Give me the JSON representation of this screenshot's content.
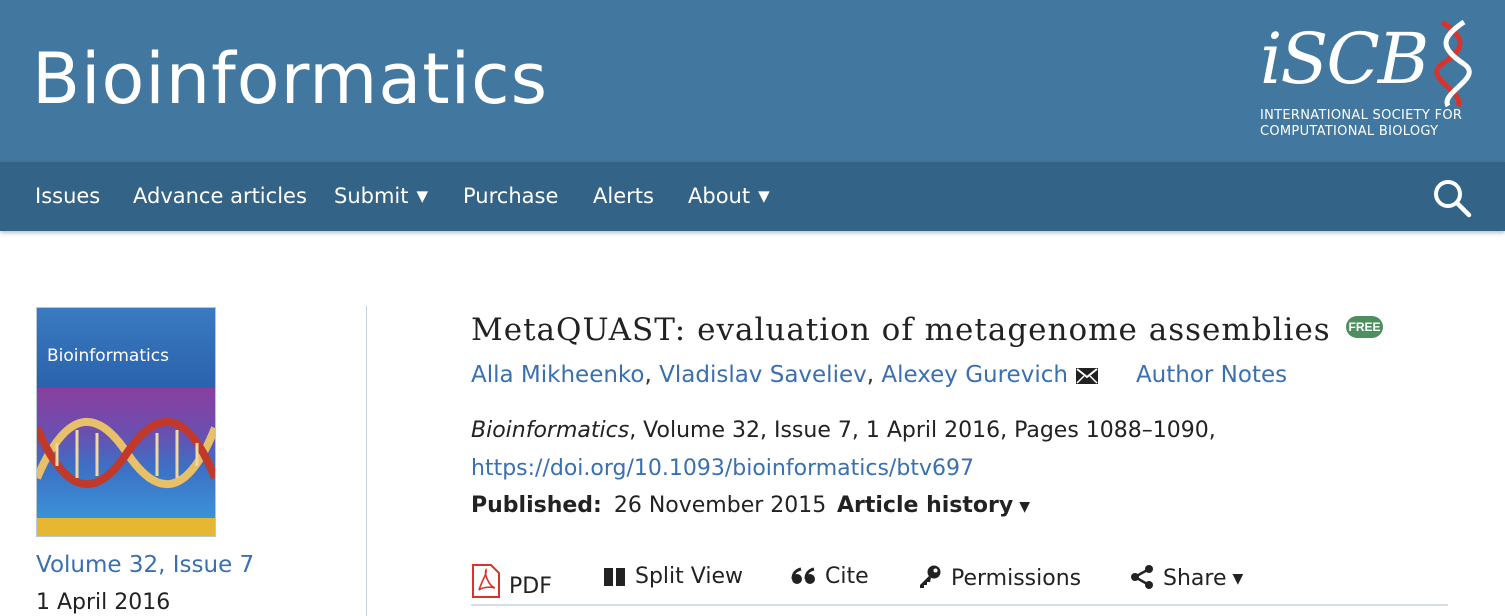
{
  "header": {
    "site_title": "Bioinformatics",
    "logo": {
      "mark": "iSCB",
      "line1": "INTERNATIONAL SOCIETY FOR",
      "line2": "COMPUTATIONAL BIOLOGY"
    },
    "background_color": "#42789f"
  },
  "nav": {
    "background_color": "#336487",
    "items": [
      {
        "label": "Issues",
        "has_dropdown": false
      },
      {
        "label": "Advance articles",
        "has_dropdown": false
      },
      {
        "label": "Submit",
        "has_dropdown": true
      },
      {
        "label": "Purchase",
        "has_dropdown": false
      },
      {
        "label": "Alerts",
        "has_dropdown": false
      },
      {
        "label": "About",
        "has_dropdown": true
      }
    ],
    "search_icon": "search-icon"
  },
  "sidebar": {
    "cover_title": "Bioinformatics",
    "volume_link": "Volume 32, Issue 7",
    "issue_date": "1 April 2016"
  },
  "article": {
    "title": "MetaQUAST: evaluation of metagenome assemblies",
    "free_badge": "FREE",
    "authors": [
      {
        "name": "Alla Mikheenko",
        "sep": ", "
      },
      {
        "name": "Vladislav Saveliev",
        "sep": ", "
      },
      {
        "name": "Alexey Gurevich",
        "sep": ""
      }
    ],
    "author_notes": "Author Notes",
    "citation": {
      "journal": "Bioinformatics",
      "rest": ", Volume 32, Issue 7, 1 April 2016, Pages 1088–1090,"
    },
    "doi": "https://doi.org/10.1093/bioinformatics/btv697",
    "published_label": "Published:",
    "published_date": "26 November 2015",
    "article_history": "Article history"
  },
  "toolbar": {
    "pdf": "PDF",
    "split_view": "Split View",
    "cite": "Cite",
    "permissions": "Permissions",
    "share": "Share"
  },
  "colors": {
    "link": "#3a6fb0",
    "free_badge": "#4f8e5f",
    "logo_accent": "#d6342c"
  }
}
